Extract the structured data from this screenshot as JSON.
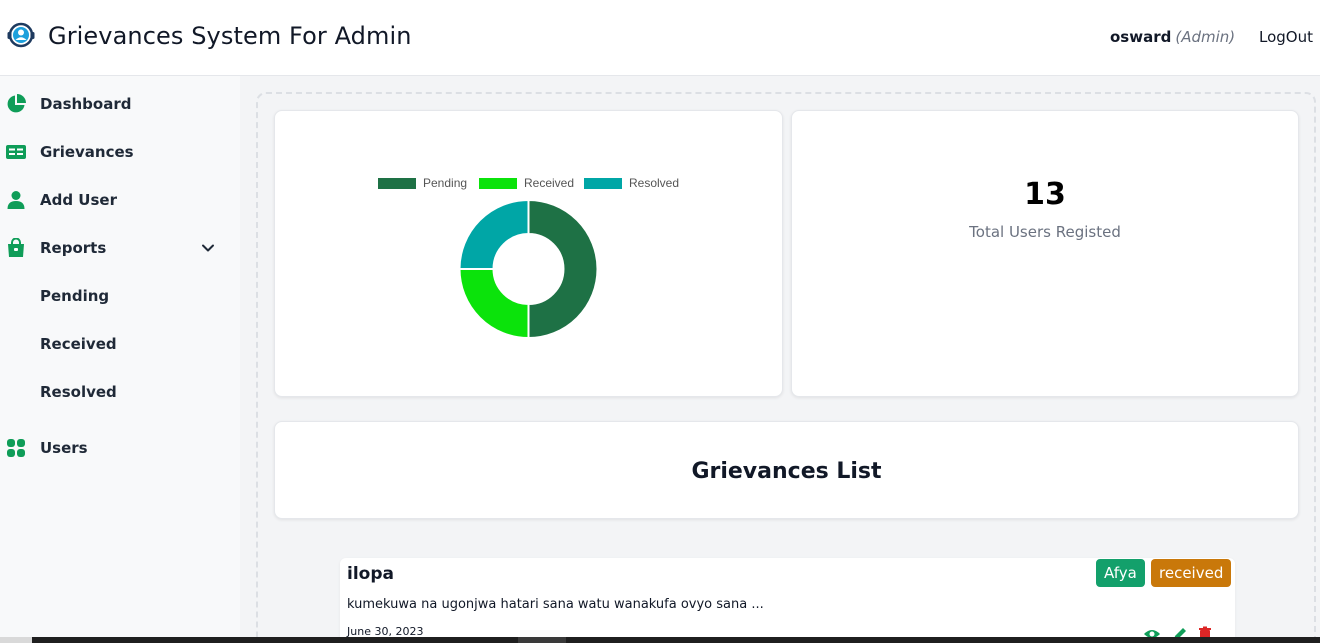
{
  "header": {
    "title": "Grievances System For Admin",
    "user_name": "osward",
    "user_role": "(Admin)",
    "logout_label": "LogOut"
  },
  "sidebar": {
    "items": [
      {
        "label": "Dashboard",
        "icon": "pie-chart-icon"
      },
      {
        "label": "Grievances",
        "icon": "card-list-icon"
      },
      {
        "label": "Add User",
        "icon": "person-icon"
      },
      {
        "label": "Reports",
        "icon": "bag-icon",
        "expanded": true
      },
      {
        "label": "Pending"
      },
      {
        "label": "Received"
      },
      {
        "label": "Resolved"
      },
      {
        "label": "Users",
        "icon": "grid-icon"
      }
    ]
  },
  "dashboard": {
    "total_users": "13",
    "total_users_label": "Total Users Registed",
    "list_title": "Grievances List"
  },
  "chart_data": {
    "type": "pie",
    "donut": true,
    "title": "",
    "legend_position": "top",
    "categories": [
      "Pending",
      "Received",
      "Resolved"
    ],
    "values": [
      50,
      25,
      25
    ],
    "colors": [
      "#1e7145",
      "#0be30b",
      "#00a6a6"
    ]
  },
  "grievance": {
    "title": "ilopa",
    "category": "Afya",
    "status": "received",
    "description": "kumekuwa na ugonjwa hatari sana watu wanakufa ovyo sana ...",
    "date": "June 30, 2023"
  },
  "colors": {
    "accent": "#13a06b",
    "status_received": "#c9780a",
    "icon_green": "#0f9d58"
  }
}
